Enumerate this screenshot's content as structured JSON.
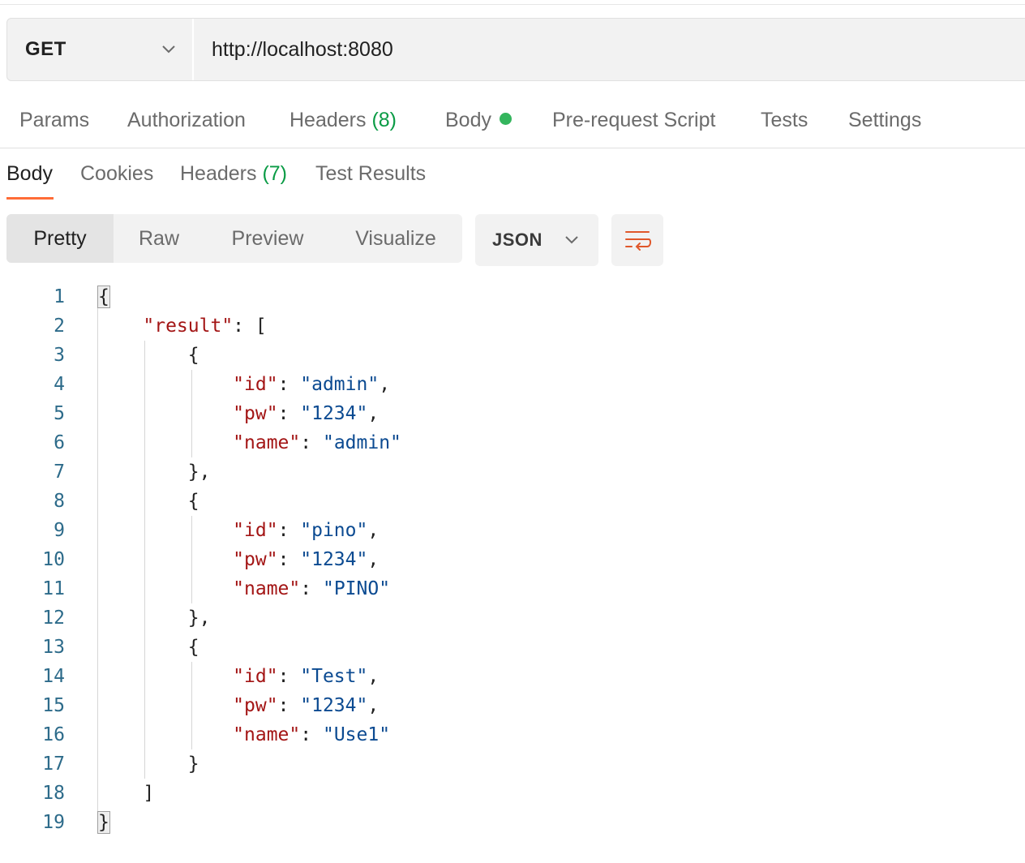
{
  "request": {
    "method": "GET",
    "url": "http://localhost:8080"
  },
  "request_tabs": {
    "params": "Params",
    "authorization": "Authorization",
    "headers": "Headers",
    "headers_count": "(8)",
    "body": "Body",
    "prerequest": "Pre-request Script",
    "tests": "Tests",
    "settings": "Settings"
  },
  "response_tabs": {
    "body": "Body",
    "cookies": "Cookies",
    "headers": "Headers",
    "headers_count": "(7)",
    "test_results": "Test Results"
  },
  "view": {
    "pretty": "Pretty",
    "raw": "Raw",
    "preview": "Preview",
    "visualize": "Visualize",
    "format": "JSON"
  },
  "colors": {
    "accent": "#ff6c37",
    "status_dot": "#34b55d",
    "json_key": "#a31515",
    "json_string": "#0b4a91"
  },
  "code": {
    "line_numbers": [
      "1",
      "2",
      "3",
      "4",
      "5",
      "6",
      "7",
      "8",
      "9",
      "10",
      "11",
      "12",
      "13",
      "14",
      "15",
      "16",
      "17",
      "18",
      "19"
    ],
    "key_result": "\"result\"",
    "records": [
      {
        "key_id": "\"id\"",
        "val_id": "\"admin\"",
        "key_pw": "\"pw\"",
        "val_pw": "\"1234\"",
        "key_name": "\"name\"",
        "val_name": "\"admin\""
      },
      {
        "key_id": "\"id\"",
        "val_id": "\"pino\"",
        "key_pw": "\"pw\"",
        "val_pw": "\"1234\"",
        "key_name": "\"name\"",
        "val_name": "\"PINO\""
      },
      {
        "key_id": "\"id\"",
        "val_id": "\"Test\"",
        "key_pw": "\"pw\"",
        "val_pw": "\"1234\"",
        "key_name": "\"name\"",
        "val_name": "\"Use1\""
      }
    ]
  }
}
